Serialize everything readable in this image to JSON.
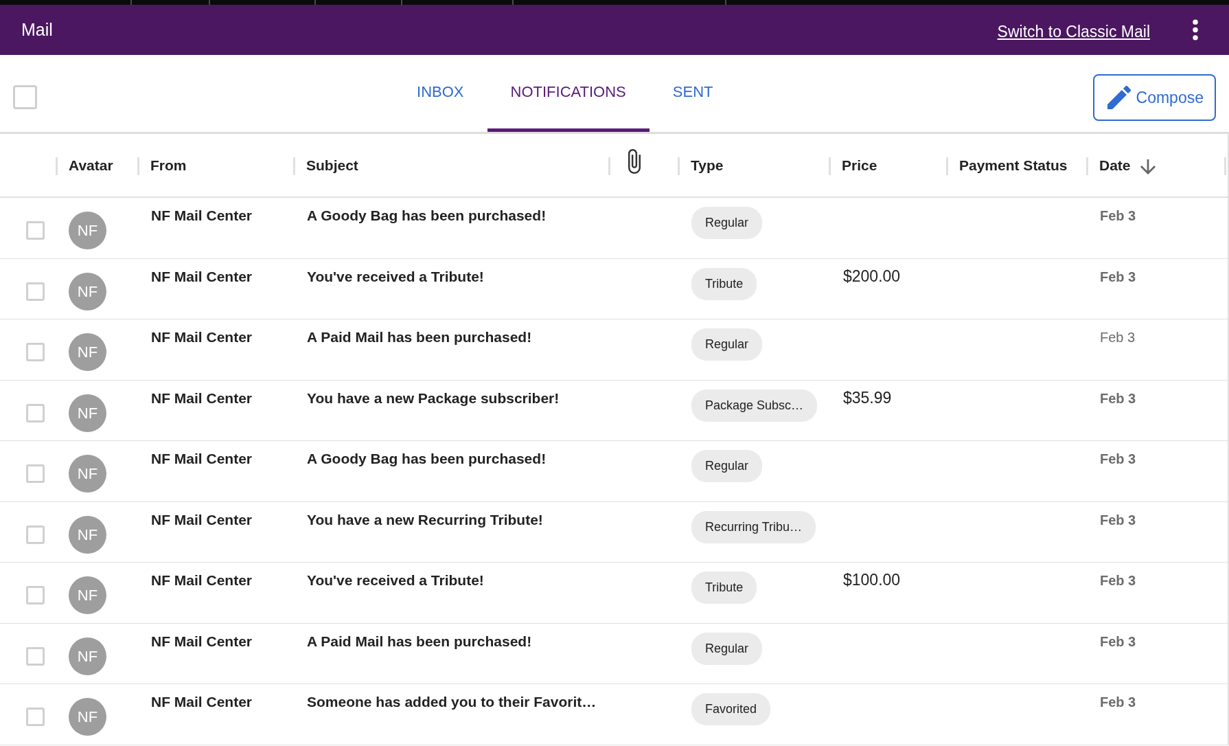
{
  "app_bar": {
    "title": "Mail",
    "link": "Switch to Classic Mail"
  },
  "toolbar": {
    "select_all": {
      "checked": false
    },
    "tabs": [
      {
        "label": "INBOX",
        "selected": false
      },
      {
        "label": "NOTIFICATIONS",
        "selected": true
      },
      {
        "label": "SENT",
        "selected": false
      }
    ],
    "compose_button": {
      "label": "Compose"
    }
  },
  "table": {
    "columns": [
      {
        "kind": "text",
        "label": "Avatar",
        "sorted": false
      },
      {
        "kind": "text",
        "label": "From",
        "sorted": false
      },
      {
        "kind": "text",
        "label": "Subject",
        "sorted": false
      },
      {
        "kind": "attachment",
        "sorted": false
      },
      {
        "kind": "text",
        "label": "Type",
        "sorted": false
      },
      {
        "kind": "text",
        "label": "Price",
        "sorted": false
      },
      {
        "kind": "text",
        "label": "Payment Status",
        "sorted": false
      },
      {
        "kind": "text",
        "label": "Date",
        "sorted": true
      }
    ],
    "rows": [
      {
        "checked": false,
        "avatar": "NF",
        "from": "NF Mail Center",
        "subject": "A Goody Bag has been purchased!",
        "type": "Regular",
        "date": "Feb 3",
        "date_bold": true
      },
      {
        "checked": false,
        "avatar": "NF",
        "from": "NF Mail Center",
        "subject": "You've received a Tribute!",
        "type": "Tribute",
        "price": "$200.00",
        "date": "Feb 3",
        "date_bold": true
      },
      {
        "checked": false,
        "avatar": "NF",
        "from": "NF Mail Center",
        "subject": "A Paid Mail has been purchased!",
        "type": "Regular",
        "date": "Feb 3",
        "date_bold": false
      },
      {
        "checked": false,
        "avatar": "NF",
        "from": "NF Mail Center",
        "subject": "You have a new Package subscriber!",
        "type": "Package Subsc…",
        "price": "$35.99",
        "date": "Feb 3",
        "date_bold": true
      },
      {
        "checked": false,
        "avatar": "NF",
        "from": "NF Mail Center",
        "subject": "A Goody Bag has been purchased!",
        "type": "Regular",
        "date": "Feb 3",
        "date_bold": true
      },
      {
        "checked": false,
        "avatar": "NF",
        "from": "NF Mail Center",
        "subject": "You have a new Recurring Tribute!",
        "type": "Recurring Tribu…",
        "date": "Feb 3",
        "date_bold": true
      },
      {
        "checked": false,
        "avatar": "NF",
        "from": "NF Mail Center",
        "subject": "You've received a Tribute!",
        "type": "Tribute",
        "price": "$100.00",
        "date": "Feb 3",
        "date_bold": true
      },
      {
        "checked": false,
        "avatar": "NF",
        "from": "NF Mail Center",
        "subject": "A Paid Mail has been purchased!",
        "type": "Regular",
        "date": "Feb 3",
        "date_bold": true
      },
      {
        "checked": false,
        "avatar": "NF",
        "from": "NF Mail Center",
        "subject": "Someone has added you to their Favorit…",
        "type": "Favorited",
        "date": "Feb 3",
        "date_bold": true
      }
    ]
  }
}
